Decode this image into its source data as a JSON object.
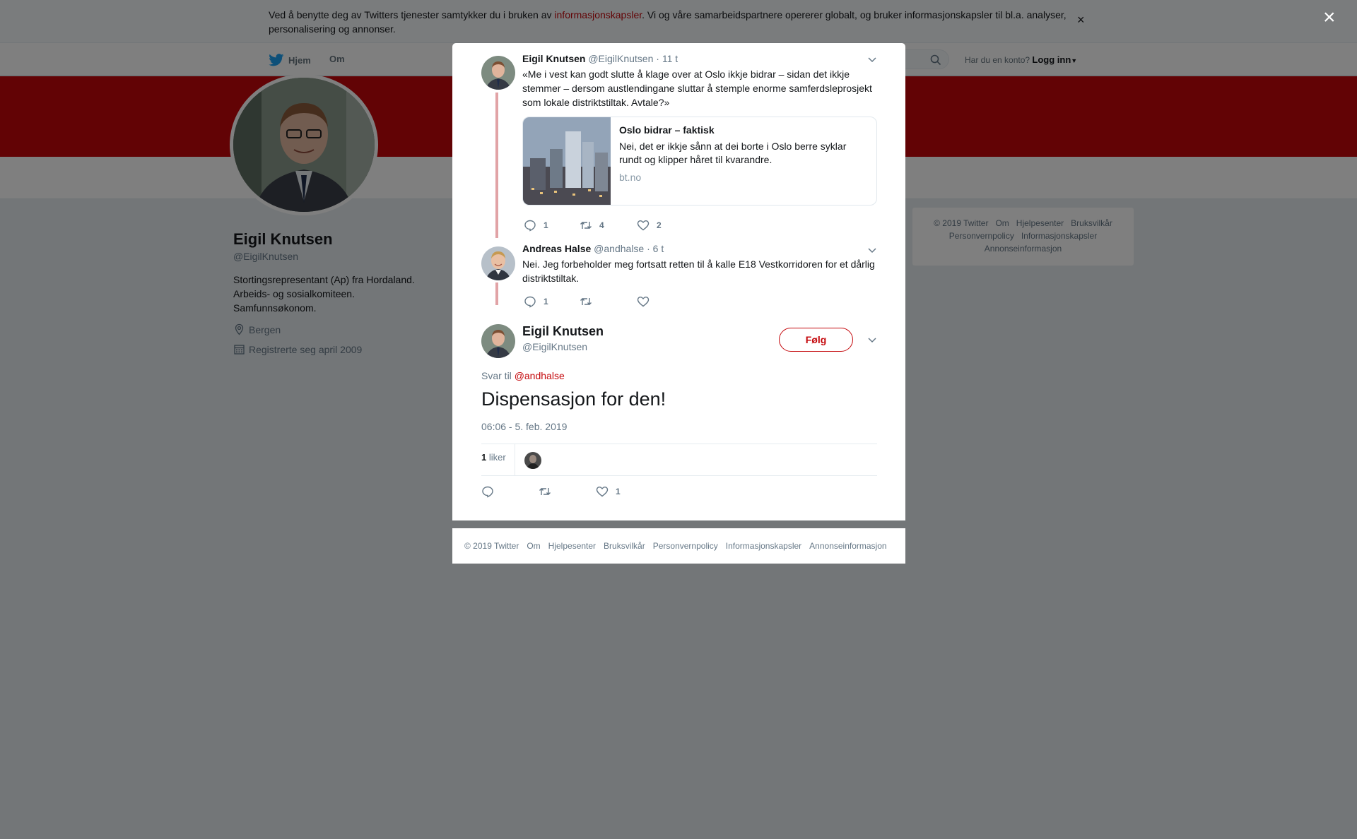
{
  "cookie_bar": {
    "text_before": "Ved å benytte deg av Twitters tjenester samtykker du i bruken av ",
    "link": "informasjonskapsler",
    "text_after": ". Vi og våre samarbeidspartnere opererer globalt, og bruker informasjonskapsler til bl.a. analyser, personalisering og annonser.",
    "close": "×"
  },
  "topnav": {
    "home": "Hjem",
    "about": "Om",
    "login_prompt": "Har du en konto?",
    "login": "Logg inn"
  },
  "profile": {
    "name": "Eigil Knutsen",
    "handle": "@EigilKnutsen",
    "bio_lines": [
      "Stortingsrepresentant (Ap) fra Hordaland.",
      "Arbeids- og sosialkomiteen.",
      "Samfunnsøkonom."
    ],
    "location": "Bergen",
    "joined": "Registrerte seg april 2009"
  },
  "side_footer": {
    "line1": [
      "© 2019 Twitter",
      "Om",
      "Hjelpesenter",
      "Bruksvilkår"
    ],
    "line2": [
      "Personvernpolicy",
      "Informasjonskapsler"
    ],
    "line3": [
      "Annonseinformasjon"
    ]
  },
  "overlay_close": "×",
  "modal": {
    "tweet1": {
      "name": "Eigil Knutsen",
      "handle": "@EigilKnutsen",
      "time": "· 11 t",
      "text": "«Me i vest kan godt slutte å klage over at Oslo ikkje bidrar – sidan det ikkje stemmer – dersom austlendingane sluttar å stemple enorme samferdsleprosjekt som lokale distriktstiltak. Avtale?»",
      "card": {
        "title": "Oslo bidrar – faktisk",
        "description": "Nei, det er ikkje sånn at dei borte i Oslo berre syklar rundt og klipper håret til kvarandre.",
        "domain": "bt.no"
      },
      "replies": "1",
      "retweets": "4",
      "likes": "2"
    },
    "tweet2": {
      "name": "Andreas Halse",
      "handle": "@andhalse",
      "time": "· 6 t",
      "text": "Nei. Jeg forbeholder meg fortsatt retten til å kalle E18 Vestkorridoren for et dårlig distriktstiltak.",
      "replies": "1",
      "retweets": "",
      "likes": ""
    },
    "main": {
      "name": "Eigil Knutsen",
      "handle": "@EigilKnutsen",
      "follow": "Følg",
      "reply_prefix": "Svar til",
      "reply_handle": "@andhalse",
      "text": "Dispensasjon for den!",
      "timestamp": "06:06 - 5. feb. 2019",
      "likes_count": "1",
      "likes_label": "liker",
      "action_likes": "1"
    }
  },
  "modal_footer": [
    "© 2019 Twitter",
    "Om",
    "Hjelpesenter",
    "Bruksvilkår",
    "Personvernpolicy",
    "Informasjonskapsler",
    "Annonseinformasjon"
  ],
  "colors": {
    "brand_red": "#c4070b",
    "thread_line": "#e1a3a6",
    "secondary_text": "#657786"
  }
}
